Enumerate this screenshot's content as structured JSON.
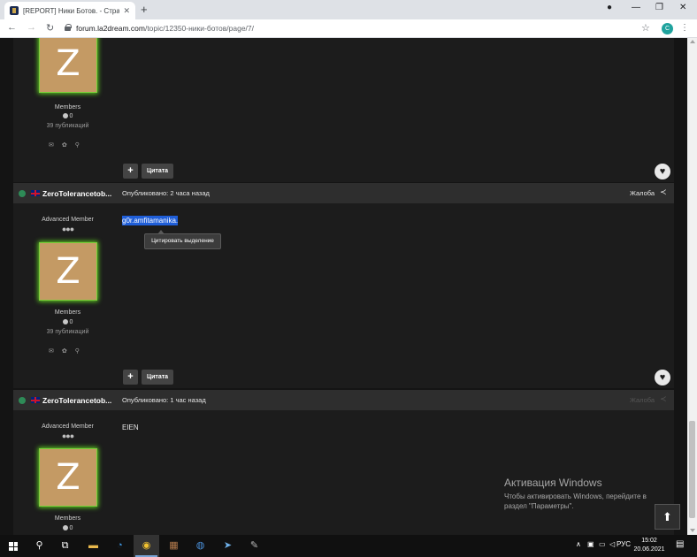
{
  "browser": {
    "tab_title": "[REPORT] Ники Ботов. - Страни...",
    "tab_close": "✕",
    "new_tab": "+",
    "url_host": "forum.la2dream.com",
    "url_path": "/topic/12350-ники-ботов/page/7/",
    "profile_letter": "C",
    "window_controls": {
      "record": "●",
      "minimize": "—",
      "restore": "❐",
      "close": "✕"
    },
    "nav": {
      "back": "←",
      "forward": "→",
      "reload": "↻"
    },
    "star": "☆",
    "menu": "⋮"
  },
  "forum": {
    "top_user": {
      "group": "Members",
      "reputation": "0",
      "publications": "39 публикаций"
    },
    "posts": [
      {
        "username": "ZeroTolerancetob...",
        "posted": "Опубликовано: 2 часа назад",
        "report": "Жалоба",
        "rank": "Advanced Member",
        "rank_dots": "●●●",
        "avatar_letter": "Z",
        "group": "Members",
        "reputation": "0",
        "publications": "39 публикаций",
        "content": "g0r.amfitamanika.",
        "tooltip": "Цитировать выделение"
      },
      {
        "username": "ZeroTolerancetob...",
        "posted": "Опубликовано: 1 час назад",
        "report": "Жалоба",
        "rank": "Advanced Member",
        "rank_dots": "●●●",
        "avatar_letter": "Z",
        "group": "Members",
        "reputation": "0",
        "content": "EIEN"
      }
    ],
    "actions": {
      "plus": "+",
      "quote": "Цитата"
    },
    "avatar_letter": "Z",
    "icons": {
      "mail": "✉",
      "settings": "✿",
      "search": "⚲",
      "like": "♥",
      "share": "≺",
      "back_to_top": "⬆"
    }
  },
  "watermark": {
    "title": "Активация Windows",
    "line1": "Чтобы активировать Windows, перейдите в",
    "line2": "раздел \"Параметры\"."
  },
  "taskbar": {
    "language": "РУС",
    "time": "15:02",
    "date": "20.06.2021",
    "tray_chevron": "∧"
  },
  "colors": {
    "page_bg": "#141414",
    "post_header": "#2e2e2e",
    "avatar_bg": "#c49a64",
    "avatar_glow": "#5fcf22",
    "selection": "#1f5ed8",
    "online": "#2e8b57"
  }
}
